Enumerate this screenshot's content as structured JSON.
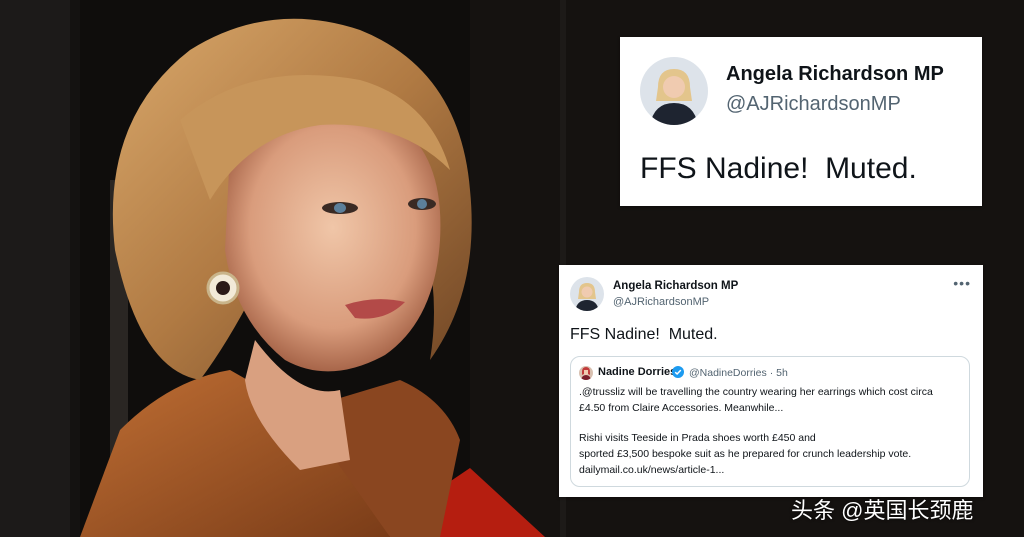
{
  "photo": {
    "subject": "woman-portrait"
  },
  "tweet_large": {
    "name": "Angela Richardson MP",
    "handle": "@AJRichardsonMP",
    "text": "FFS Nadine!  Muted."
  },
  "tweet_small": {
    "name": "Angela Richardson MP",
    "handle": "@AJRichardsonMP",
    "more": "•••",
    "text": "FFS Nadine!  Muted.",
    "quote": {
      "name": "Nadine Dorries",
      "handle": "@NadineDorries · 5h",
      "lines": [
        ".@trussliz will be travelling the country wearing her earrings which cost circa",
        "£4.50 from Claire Accessories. Meanwhile...",
        "Rishi visits Teeside in Prada shoes worth £450 and",
        "sported £3,500 bespoke suit as he prepared for crunch leadership vote.",
        "dailymail.co.uk/news/article-1..."
      ]
    }
  },
  "watermark": "头条 @英国长颈鹿",
  "colors": {
    "card_bg": "#ffffff",
    "text": "#0f1419",
    "muted": "#536471",
    "verified": "#1d9bf0",
    "jacket": "#a0582a"
  }
}
